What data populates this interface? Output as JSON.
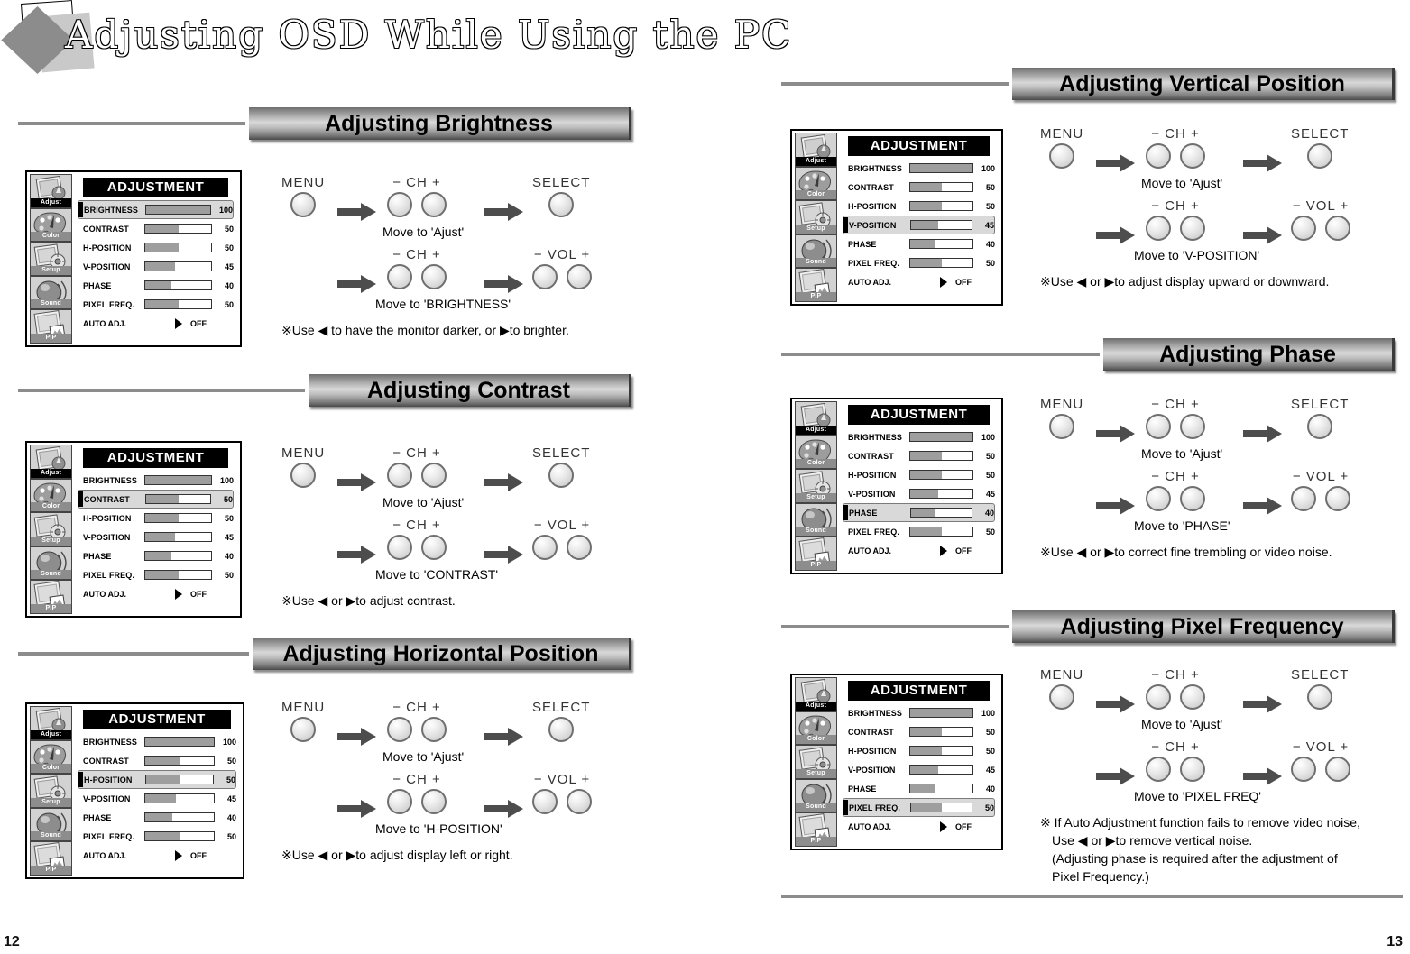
{
  "document": {
    "title": "Adjusting OSD While Using the PC",
    "page_left": "12",
    "page_right": "13"
  },
  "osd_menu": {
    "panel_title": "ADJUSTMENT",
    "sidebar": [
      {
        "label": "Adjust",
        "icon": "adjust-icon"
      },
      {
        "label": "Color",
        "icon": "color-palette-icon"
      },
      {
        "label": "Setup",
        "icon": "setup-icon"
      },
      {
        "label": "Sound",
        "icon": "sound-icon"
      },
      {
        "label": "PIP",
        "icon": "pip-icon"
      }
    ],
    "rows": [
      {
        "label": "BRIGHTNESS",
        "value": "100",
        "percent": 100
      },
      {
        "label": "CONTRAST",
        "value": "50",
        "percent": 50
      },
      {
        "label": "H-POSITION",
        "value": "50",
        "percent": 50
      },
      {
        "label": "V-POSITION",
        "value": "45",
        "percent": 45
      },
      {
        "label": "PHASE",
        "value": "40",
        "percent": 40
      },
      {
        "label": "PIXEL FREQ.",
        "value": "50",
        "percent": 50
      }
    ],
    "auto_row": {
      "label": "AUTO ADJ.",
      "value": "OFF"
    }
  },
  "button_labels": {
    "menu": "MENU",
    "ch": "− CH +",
    "select": "SELECT",
    "vol": "− VOL +"
  },
  "sections": [
    {
      "id": "brightness",
      "heading": "Adjusting Brightness",
      "selected_row": "BRIGHTNESS",
      "move_first": "Move to 'Ajust'",
      "move_second": "Move to 'BRIGHTNESS'",
      "note": "※Use ◀ to have the monitor darker, or ▶to brighter."
    },
    {
      "id": "contrast",
      "heading": "Adjusting Contrast",
      "selected_row": "CONTRAST",
      "move_first": "Move to 'Ajust'",
      "move_second": "Move to 'CONTRAST'",
      "note": "※Use ◀ or ▶to adjust contrast."
    },
    {
      "id": "h-position",
      "heading": "Adjusting Horizontal Position",
      "selected_row": "H-POSITION",
      "move_first": "Move to 'Ajust'",
      "move_second": "Move to 'H-POSITION'",
      "note": "※Use ◀ or ▶to adjust display left or right."
    },
    {
      "id": "v-position",
      "heading": "Adjusting Vertical Position",
      "selected_row": "V-POSITION",
      "move_first": "Move to 'Ajust'",
      "move_second": "Move to 'V-POSITION'",
      "note": "※Use ◀ or ▶to adjust display upward or downward."
    },
    {
      "id": "phase",
      "heading": "Adjusting Phase",
      "selected_row": "PHASE",
      "move_first": "Move to 'Ajust'",
      "move_second": "Move to 'PHASE'",
      "note": "※Use ◀ or ▶to correct fine trembling or video noise."
    },
    {
      "id": "pixel-frequency",
      "heading": "Adjusting Pixel Frequency",
      "selected_row": "PIXEL FREQ.",
      "move_first": "Move to 'Ajust'",
      "move_second": "Move to 'PIXEL FREQ'",
      "note_lines": [
        "※ If Auto Adjustment function fails to remove video noise,",
        "Use ◀ or ▶to remove vertical noise.",
        "(Adjusting phase is required after the adjustment of",
        "Pixel Frequency.)"
      ]
    }
  ],
  "colors": {
    "bar_fill": "#9e9e9e",
    "selected_row_bg": "#d9d9d9",
    "title_bar_bg": "#000000",
    "rule": "#8c8c8c"
  }
}
